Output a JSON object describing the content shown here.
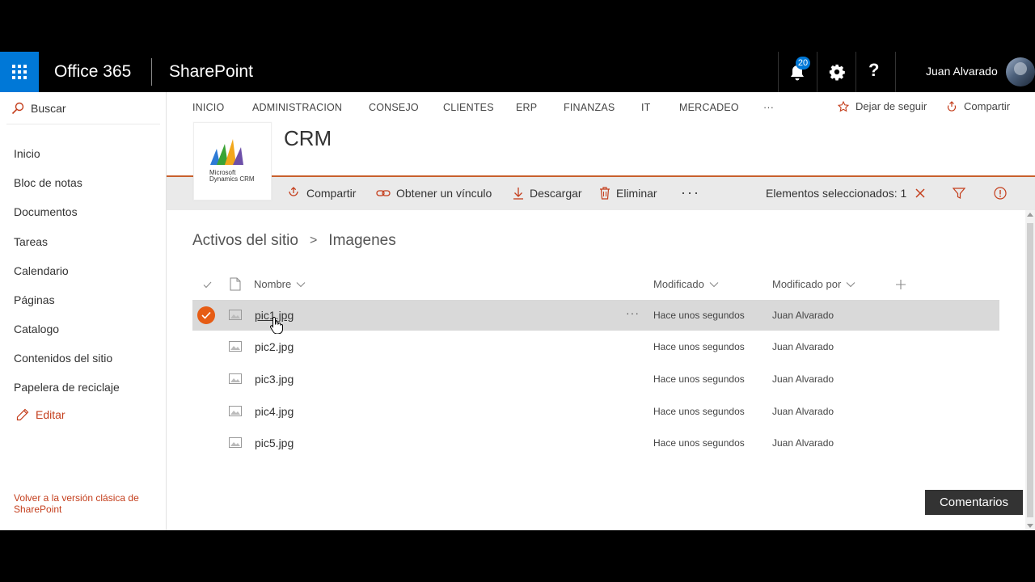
{
  "suitebar": {
    "brand": "Office 365",
    "app": "SharePoint",
    "notification_count": "20",
    "help_label": "?",
    "user_name": "Juan Alvarado"
  },
  "leftnav": {
    "search_label": "Buscar",
    "items": [
      "Inicio",
      "Bloc de notas",
      "Documentos",
      "Tareas",
      "Calendario",
      "Páginas",
      "Catalogo",
      "Contenidos del sitio",
      "Papelera de reciclaje"
    ],
    "edit_label": "Editar",
    "classic_link": "Volver a la versión clásica de SharePoint"
  },
  "topnav": {
    "items": [
      "INICIO",
      "ADMINISTRACION",
      "CONSEJO",
      "CLIENTES",
      "ERP",
      "FINANZAS",
      "IT",
      "MERCADEO",
      "···"
    ],
    "follow_label": "Dejar de seguir",
    "share_label": "Compartir"
  },
  "site": {
    "logo_line1": "Microsoft",
    "logo_line2": "Dynamics CRM",
    "title": "CRM"
  },
  "cmdbar": {
    "share": "Compartir",
    "get_link": "Obtener un vínculo",
    "download": "Descargar",
    "delete": "Eliminar",
    "more": "···",
    "selected": "Elementos seleccionados: 1"
  },
  "breadcrumb": {
    "root": "Activos del sitio",
    "separator": ">",
    "current": "Imagenes"
  },
  "list": {
    "columns": {
      "name": "Nombre",
      "modified": "Modificado",
      "modified_by": "Modificado por"
    },
    "more_label": "···",
    "rows": [
      {
        "name": "pic1.jpg",
        "modified": "Hace unos segundos",
        "by": "Juan Alvarado"
      },
      {
        "name": "pic2.jpg",
        "modified": "Hace unos segundos",
        "by": "Juan Alvarado"
      },
      {
        "name": "pic3.jpg",
        "modified": "Hace unos segundos",
        "by": "Juan Alvarado"
      },
      {
        "name": "pic4.jpg",
        "modified": "Hace unos segundos",
        "by": "Juan Alvarado"
      },
      {
        "name": "pic5.jpg",
        "modified": "Hace unos segundos",
        "by": "Juan Alvarado"
      }
    ]
  },
  "feedback_label": "Comentarios",
  "colors": {
    "accent": "#c43e1c",
    "waffle": "#0078d7",
    "selection_check": "#e65c14"
  }
}
